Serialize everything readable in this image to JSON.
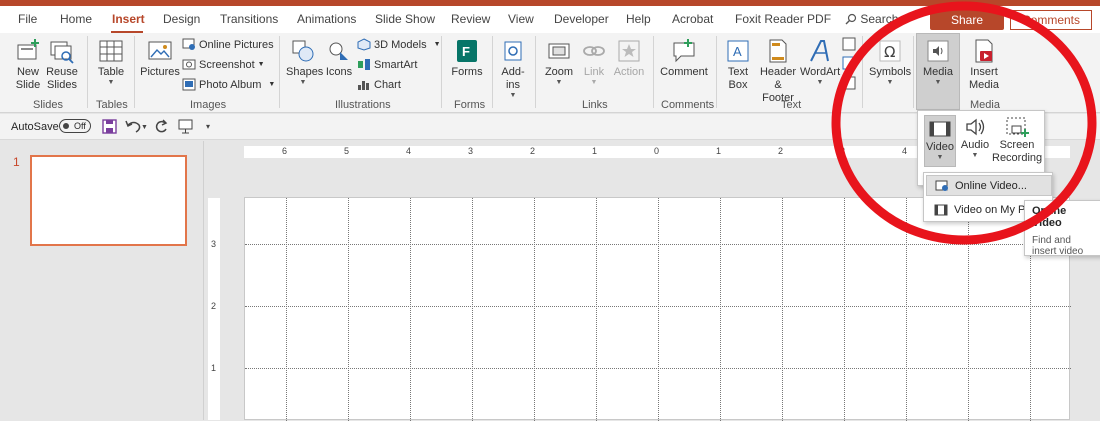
{
  "tabs": [
    "File",
    "Home",
    "Insert",
    "Design",
    "Transitions",
    "Animations",
    "Slide Show",
    "Review",
    "View",
    "Developer",
    "Help",
    "Acrobat",
    "Foxit Reader PDF"
  ],
  "search_label": "Search",
  "share_label": "Share",
  "comments_label": "Comments",
  "ribbon": {
    "new_slide": "New Slide",
    "reuse_slides": "Reuse Slides",
    "slides_group": "Slides",
    "table": "Table",
    "tables_group": "Tables",
    "pictures": "Pictures",
    "online_pictures": "Online Pictures",
    "screenshot": "Screenshot",
    "photo_album": "Photo Album",
    "images_group": "Images",
    "shapes": "Shapes",
    "icons": "Icons",
    "models_3d": "3D Models",
    "smartart": "SmartArt",
    "chart": "Chart",
    "illustrations_group": "Illustrations",
    "forms": "Forms",
    "forms_group": "Forms",
    "addins": "Add-ins",
    "zoom": "Zoom",
    "link": "Link",
    "action": "Action",
    "links_group": "Links",
    "comment": "Comment",
    "comments_group": "Comments",
    "text_box": "Text Box",
    "header_footer": "Header & Footer",
    "wordart": "WordArt",
    "text_group": "Text",
    "symbols": "Symbols",
    "media": "Media",
    "insert_media": "Insert Media",
    "media_group": "Media"
  },
  "qat": {
    "autosave": "AutoSave",
    "toggle": "Off"
  },
  "slide_number": "1",
  "ruler_h": [
    "6",
    "5",
    "4",
    "3",
    "2",
    "1",
    "0",
    "1",
    "2",
    "3",
    "4"
  ],
  "ruler_v": [
    "3",
    "2",
    "1"
  ],
  "media_menu": {
    "video": "Video",
    "audio": "Audio",
    "screen_recording": "Screen Recording"
  },
  "video_menu": [
    "Online Video...",
    "Video on My PC..."
  ],
  "tooltip": {
    "title": "Online Video",
    "body": "Find and insert video from a variety of online sources."
  },
  "colors": {
    "accent": "#b7472a",
    "annotation": "#e8141c"
  }
}
